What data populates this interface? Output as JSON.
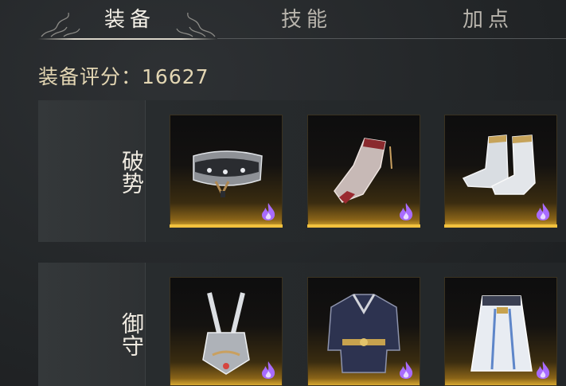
{
  "tabs": [
    {
      "label": "装备",
      "active": true
    },
    {
      "label": "技能",
      "active": false
    },
    {
      "label": "加点",
      "active": false
    }
  ],
  "score": {
    "label": "装备评分：",
    "value": "16627"
  },
  "rows": [
    {
      "label": "破势",
      "slots": [
        {
          "icon": "belt-icon",
          "rarity": "purple-flame-icon"
        },
        {
          "icon": "bracer-icon",
          "rarity": "purple-flame-icon"
        },
        {
          "icon": "boots-icon",
          "rarity": "purple-flame-icon"
        }
      ]
    },
    {
      "label": "御守",
      "slots": [
        {
          "icon": "pendant-icon",
          "rarity": "purple-flame-icon"
        },
        {
          "icon": "armor-coat-icon",
          "rarity": "purple-flame-icon"
        },
        {
          "icon": "skirt-icon",
          "rarity": "purple-flame-icon"
        }
      ]
    }
  ],
  "colors": {
    "accent_gold": "#f2c13e",
    "rarity_purple": "#a86bff",
    "score_text": "#e3d6b3"
  }
}
